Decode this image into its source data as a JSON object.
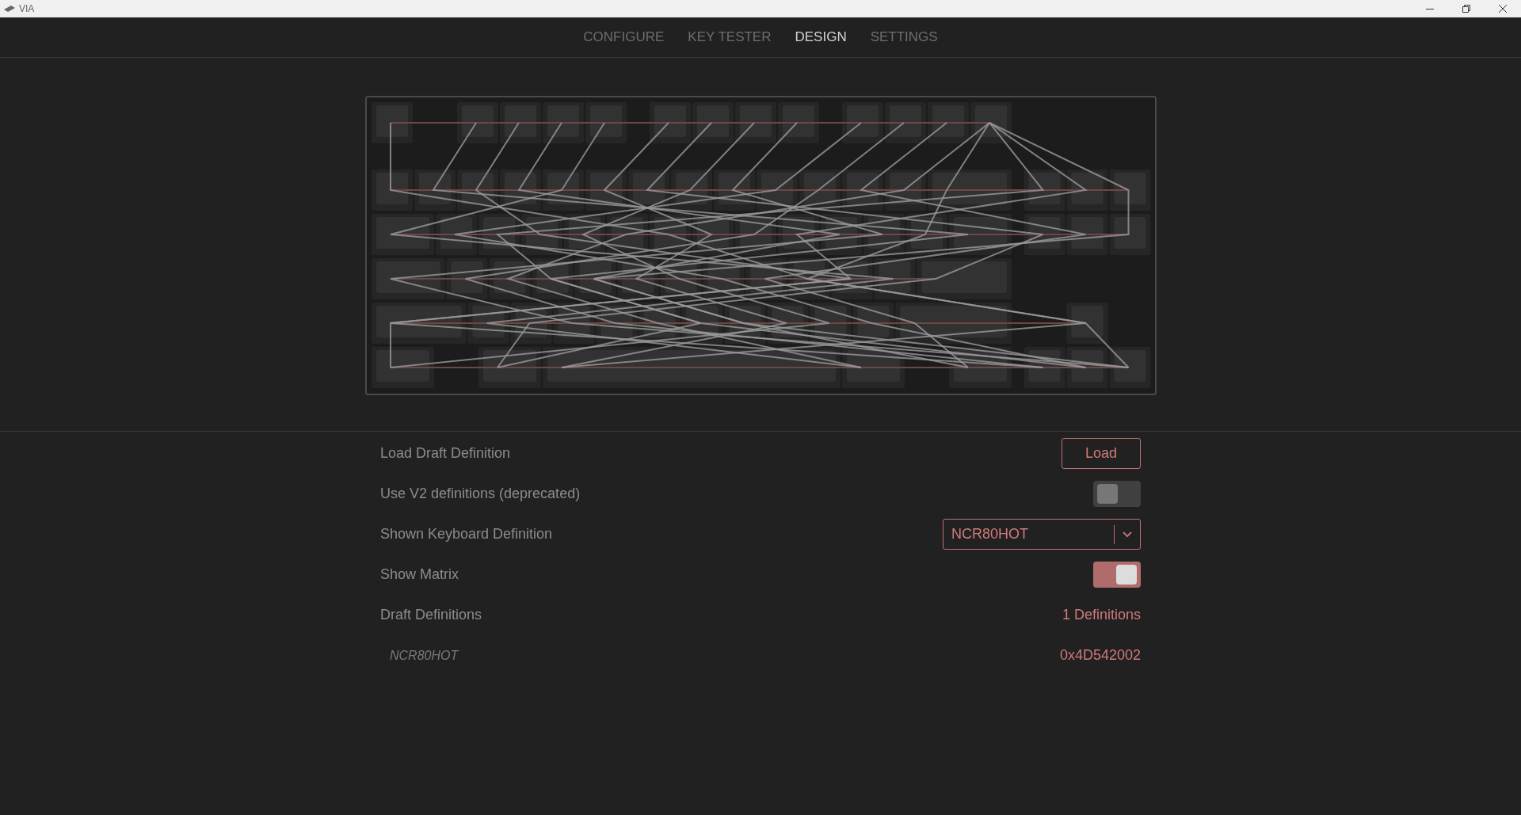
{
  "window": {
    "title": "VIA"
  },
  "tabs": [
    {
      "label": "CONFIGURE",
      "selected": false
    },
    {
      "label": "KEY TESTER",
      "selected": false
    },
    {
      "label": "DESIGN",
      "selected": true
    },
    {
      "label": "SETTINGS",
      "selected": false
    }
  ],
  "settings": [
    {
      "kind": "button",
      "label": "Load Draft Definition",
      "button": "Load"
    },
    {
      "kind": "toggle",
      "label": "Use V2 definitions (deprecated)",
      "on": false
    },
    {
      "kind": "select",
      "label": "Shown Keyboard Definition",
      "value": "NCR80HOT"
    },
    {
      "kind": "toggle",
      "label": "Show Matrix",
      "on": true
    },
    {
      "kind": "value",
      "label": "Draft Definitions",
      "value": "1 Definitions"
    }
  ],
  "definitions": [
    {
      "name": "NCR80HOT",
      "id": "0x4D542002"
    }
  ]
}
